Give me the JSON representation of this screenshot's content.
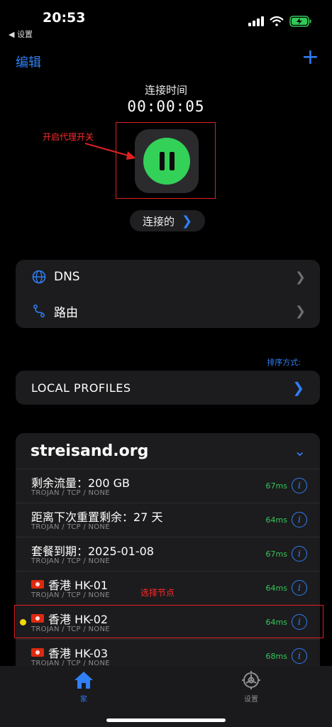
{
  "status_bar": {
    "time": "20:53",
    "back_label": "◀ 设置"
  },
  "nav": {
    "edit_label": "编辑",
    "add_label": "+"
  },
  "connection": {
    "label": "连接时间",
    "timer": "00:00:05",
    "status_label": "连接的"
  },
  "annotations": {
    "toggle_note": "开启代理开关",
    "node_note": "选择节点"
  },
  "settings_rows": [
    {
      "label": "DNS",
      "icon": "globe-icon"
    },
    {
      "label": "路由",
      "icon": "route-icon"
    }
  ],
  "sort_label": "排序方式:",
  "local_profiles": {
    "label": "LOCAL PROFILES"
  },
  "server_group": {
    "title": "streisand.org",
    "nodes": [
      {
        "name": "剩余流量：200 GB",
        "flag": false,
        "sub": "TROJAN / TCP / NONE",
        "ping": "67ms"
      },
      {
        "name": "距离下次重置剩余：27 天",
        "flag": false,
        "sub": "TROJAN / TCP / NONE",
        "ping": "64ms"
      },
      {
        "name": "套餐到期：2025-01-08",
        "flag": false,
        "sub": "TROJAN / TCP / NONE",
        "ping": "67ms"
      },
      {
        "name": "香港 HK-01",
        "flag": true,
        "sub": "TROJAN / TCP / NONE",
        "ping": "64ms"
      },
      {
        "name": "香港 HK-02",
        "flag": true,
        "sub": "TROJAN / TCP / NONE",
        "ping": "64ms",
        "selected": true
      },
      {
        "name": "香港 HK-03",
        "flag": true,
        "sub": "TROJAN / TCP / NONE",
        "ping": "68ms"
      }
    ]
  },
  "tabbar": {
    "home_label": "家",
    "settings_label": "设置"
  },
  "colors": {
    "accent": "#2f7ff5",
    "toggle": "#34d158",
    "ping": "#34c759",
    "annotation": "#e02020"
  }
}
